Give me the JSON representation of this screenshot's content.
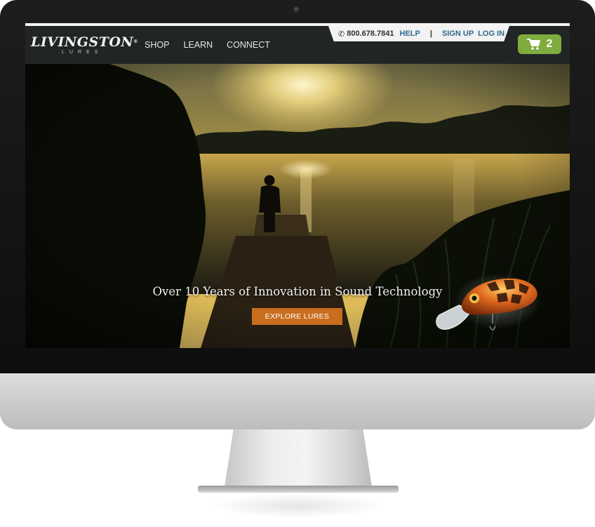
{
  "site": {
    "logo": {
      "wordmark": "LIVINGSTON",
      "tagline": "LURES"
    },
    "nav": {
      "items": [
        {
          "label": "SHOP"
        },
        {
          "label": "LEARN"
        },
        {
          "label": "CONNECT"
        }
      ]
    },
    "utility": {
      "phone_icon": "phone-icon",
      "phone": "800.678.7841",
      "help": "HELP",
      "separator": "|",
      "signup": "SIGN UP",
      "login": "LOG IN"
    },
    "cart": {
      "icon": "cart-icon",
      "count": "2"
    },
    "hero": {
      "headline": "Over 10 Years of Innovation in Sound Technology",
      "cta": "EXPLORE LURES"
    }
  },
  "colors": {
    "header_bg": "#222526",
    "link_blue": "#2e6a8f",
    "cart_green": "#7fac3e",
    "cta_orange": "#c96d1e"
  }
}
